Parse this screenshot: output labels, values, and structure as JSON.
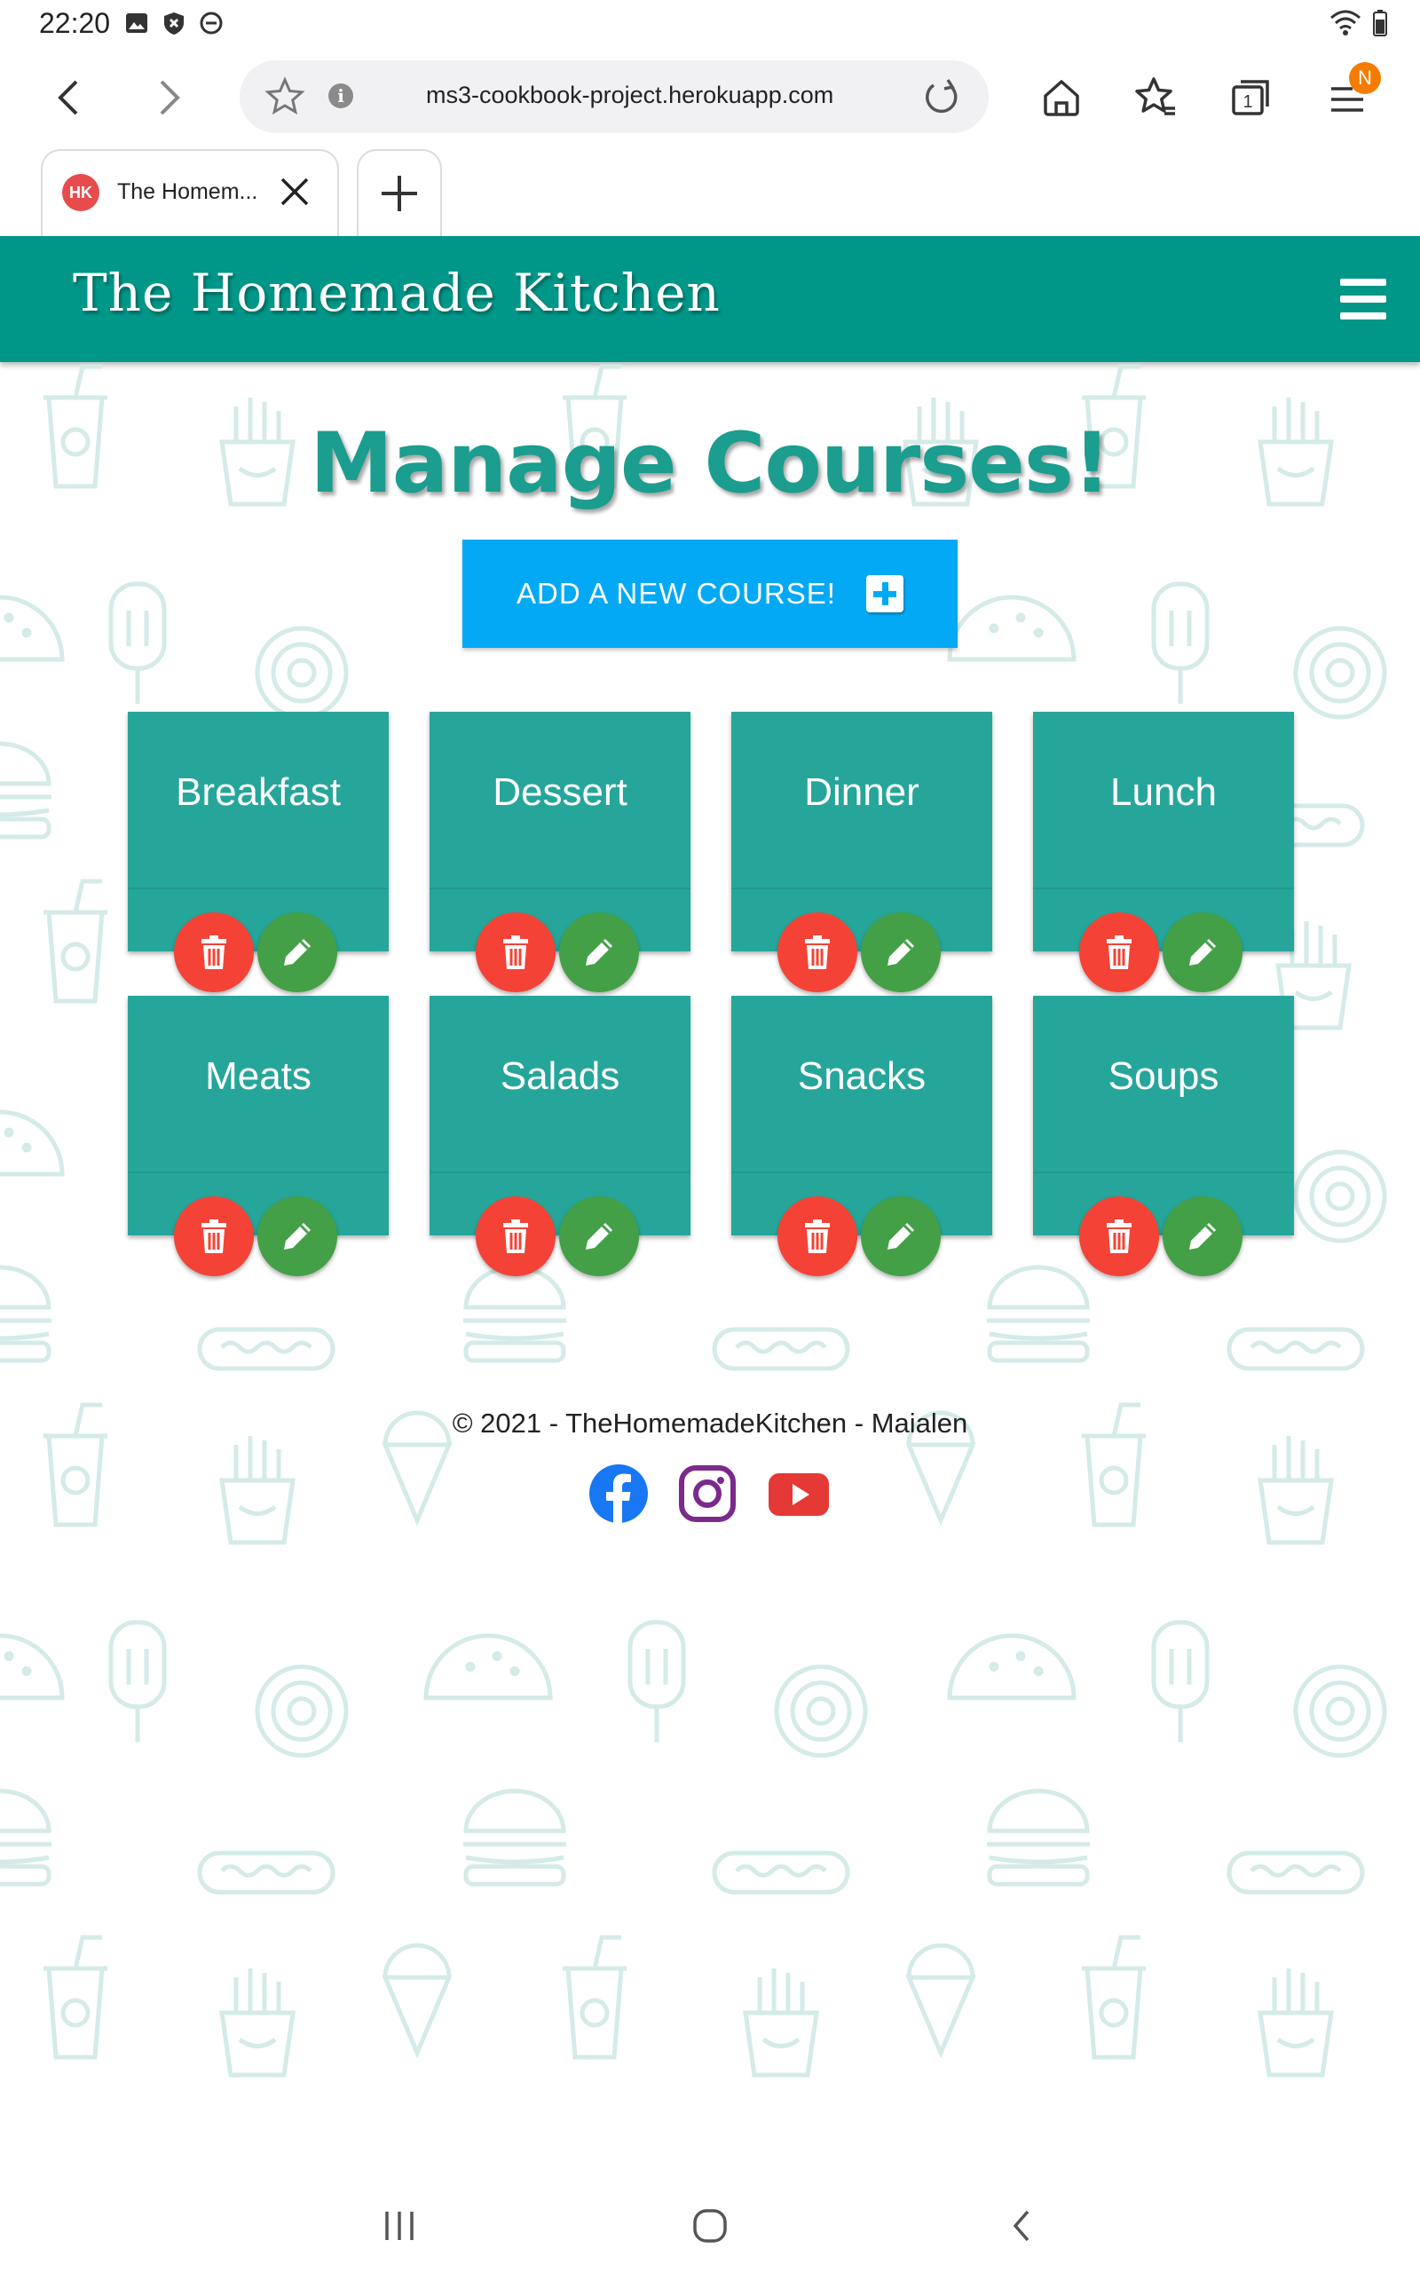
{
  "status_bar": {
    "time": "22:20"
  },
  "browser": {
    "url": "ms3-cookbook-project.herokuapp.com",
    "tab_title": "The Homem...",
    "tab_favicon_text": "HK",
    "tab_count": "1",
    "menu_badge": "N"
  },
  "site": {
    "brand": "The Homemade Kitchen",
    "page_title": "Manage Courses!",
    "add_button_label": "ADD A NEW COURSE!",
    "courses": [
      "Breakfast",
      "Dessert",
      "Dinner",
      "Lunch",
      "Meats",
      "Salads",
      "Snacks",
      "Soups"
    ],
    "footer_text": "© 2021 - TheHomemadeKitchen - Maialen"
  },
  "colors": {
    "header": "#009688",
    "card": "#26a69a",
    "title": "#1b9d8f",
    "add_button": "#03a9f4",
    "delete": "#f44336",
    "edit": "#43a047"
  },
  "icons": {
    "status": [
      "image-icon",
      "shield-icon",
      "do-not-disturb-icon",
      "wifi-icon",
      "battery-icon"
    ],
    "toolbar": [
      "back-icon",
      "forward-icon",
      "bookmark-star-icon",
      "info-icon",
      "reload-icon",
      "home-icon",
      "favorites-icon",
      "tabs-icon",
      "menu-icon"
    ],
    "card_actions": [
      "trash-icon",
      "pencil-icon"
    ],
    "social": [
      "facebook-icon",
      "instagram-icon",
      "youtube-icon"
    ],
    "system_nav": [
      "recents-icon",
      "home-circle-icon",
      "back-chevron-icon"
    ]
  }
}
